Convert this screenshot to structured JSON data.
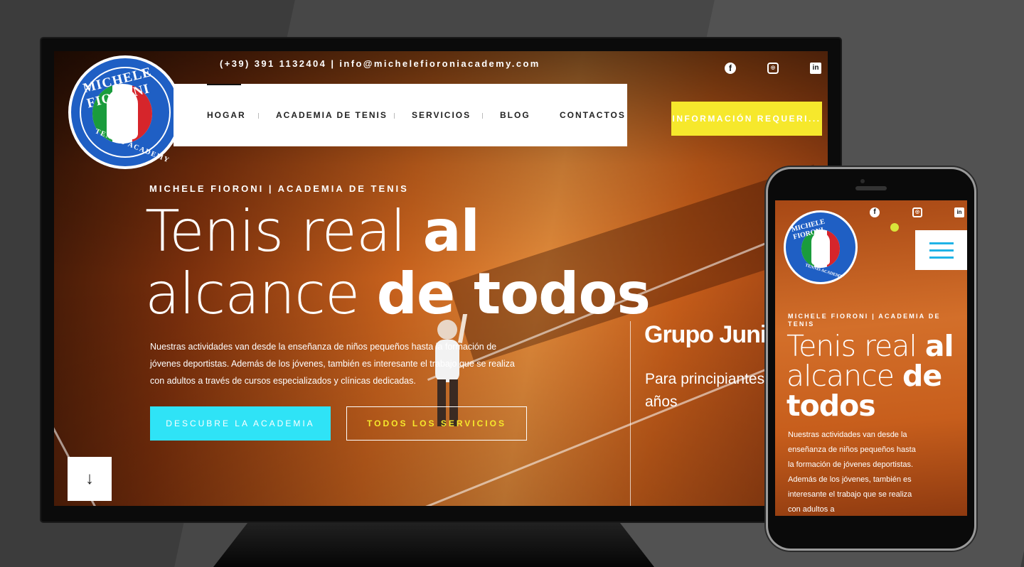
{
  "desktop": {
    "topbar": {
      "contact": "(+39) 391 1132404 | info@michelefioroniacademy.com"
    },
    "social": {
      "facebook": "f",
      "instagram": "◎",
      "linkedin": "in"
    },
    "logo": {
      "top_text": "MICHELE FIORONI",
      "bottom_text": "TENNIS ACADEMY"
    },
    "nav": {
      "items": [
        {
          "label": "HOGAR"
        },
        {
          "label": "ACADEMIA DE TENIS"
        },
        {
          "label": "SERVICIOS"
        },
        {
          "label": "BLOG"
        },
        {
          "label": "CONTACTOS"
        }
      ],
      "cta": "INFORMACIÓN REQUERI..."
    },
    "hero": {
      "kicker": "MICHELE FIORONI | ACADEMIA DE TENIS",
      "title_light_1": "Tenis real ",
      "title_bold_1": "al",
      "title_light_2": "alcance ",
      "title_bold_2": "de todos",
      "paragraph": "Nuestras actividades van desde la enseñanza de niños pequeños hasta la formación de jóvenes deportistas. Además de los jóvenes, también es interesante el trabajo que se realiza con adultos a través de cursos especializados y clínicas dedicadas.",
      "primary_button": "DESCUBRE LA ACADEMIA",
      "secondary_button": "TODOS LOS SERVICIOS",
      "scroll_icon": "↓"
    },
    "slide": {
      "title": "Grupo Junior",
      "subtitle": "Para principiantes de 5 a 7 años"
    }
  },
  "mobile": {
    "social": {
      "facebook": "f",
      "instagram": "◎",
      "linkedin": "in"
    },
    "logo": {
      "top_text": "MICHELE FIORONI",
      "bottom_text": "TENNIS ACADEMY"
    },
    "hero": {
      "kicker": "MICHELE FIORONI | ACADEMIA DE TENIS",
      "title_light_1": "Tenis real ",
      "title_bold_1": "al",
      "title_light_2": "alcance ",
      "title_bold_2": "de",
      "title_bold_3": "todos",
      "paragraph": "Nuestras actividades van desde la enseñanza de niños pequeños hasta la formación de jóvenes deportistas. Además de los jóvenes, también es interesante el trabajo que se realiza con adultos a"
    }
  },
  "colors": {
    "cta_yellow": "#f6e82c",
    "cyan": "#2fe3f6",
    "logo_blue": "#1f5fc4",
    "hamburger_blue": "#1fb3e6",
    "clay_orange": "#d36f2a"
  }
}
